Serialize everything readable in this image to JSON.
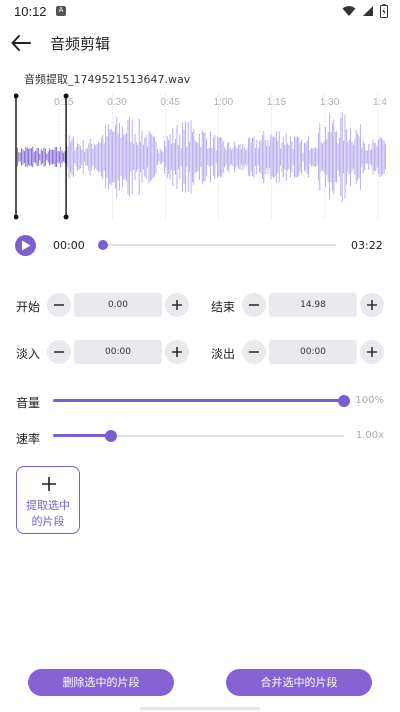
{
  "status_bar": {
    "time": "10:12",
    "notification_glyph": "A",
    "icons": [
      "wifi-icon",
      "signal-icon",
      "battery-icon"
    ]
  },
  "app_bar": {
    "back_icon": "arrow-left-icon",
    "title": "音频剪辑"
  },
  "file": {
    "name": "音频提取_1749521513647.wav"
  },
  "waveform": {
    "time_labels": [
      "0:15",
      "0:30",
      "0:45",
      "1:00",
      "1:15",
      "1:30",
      "1:4"
    ],
    "selection": {
      "start_fraction": 0.0,
      "end_fraction": 0.14
    },
    "colors": {
      "selected": "#7b5fcf",
      "unselected": "#b5a6ec",
      "handle": "#111111"
    }
  },
  "player": {
    "current_time": "00:00",
    "total_time": "03:22",
    "progress": 0.0
  },
  "params": {
    "start": {
      "label": "开始",
      "value": "0.00"
    },
    "end": {
      "label": "结束",
      "value": "14.98"
    },
    "fade_in": {
      "label": "淡入",
      "value": "00:00"
    },
    "fade_out": {
      "label": "淡出",
      "value": "00:00"
    }
  },
  "sliders": {
    "volume": {
      "label": "音量",
      "value_text": "100%",
      "fraction": 1.0
    },
    "rate": {
      "label": "速率",
      "value_text": "1.00x",
      "fraction": 0.2
    }
  },
  "extract_card": {
    "label": "提取选中的片段"
  },
  "actions": {
    "delete_label": "删除选中的片段",
    "merge_label": "合并选中的片段"
  },
  "colors": {
    "accent": "#7b5fcf",
    "button": "#8663d3",
    "stepper_bg": "#e9e9ee"
  }
}
